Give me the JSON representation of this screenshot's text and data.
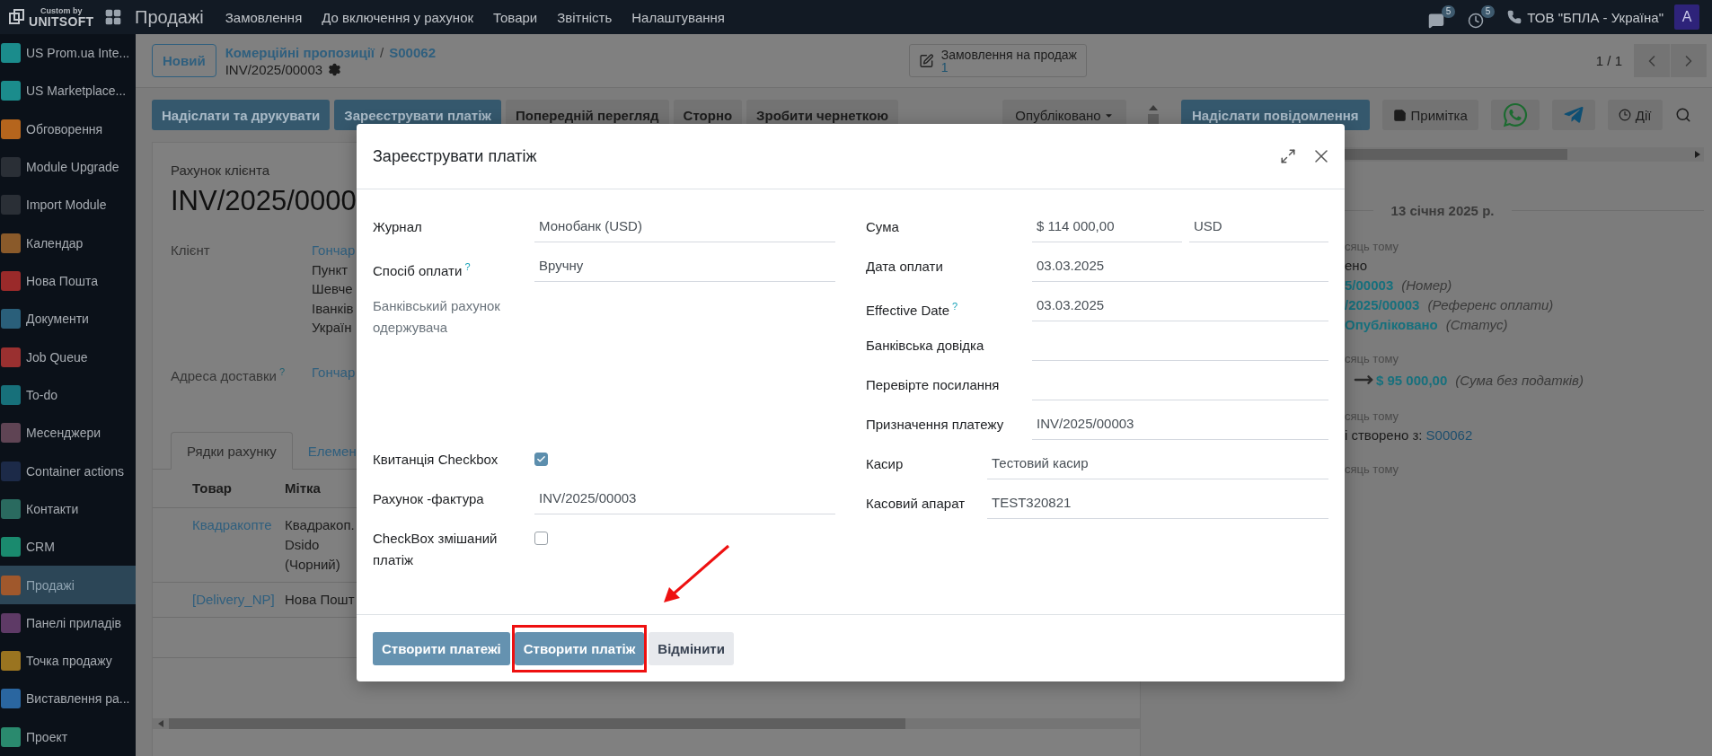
{
  "topbar": {
    "brand_caption": "Custom by",
    "brand_name": "UNITSOFT",
    "app": "Продажі",
    "menu": [
      "Замовлення",
      "До включення у рахунок",
      "Товари",
      "Звітність",
      "Налаштування"
    ],
    "messages_badge": "5",
    "activities_badge": "5",
    "company": "ТОВ \"БПЛА - Україна\"",
    "avatar": "A"
  },
  "sidebar": {
    "items": [
      {
        "label": "US Prom.ua Inte...",
        "selected": false,
        "color": "#1b8c8c"
      },
      {
        "label": "US Marketplace...",
        "selected": false,
        "color": "#1b8c8c"
      },
      {
        "label": "Обговорення",
        "selected": false,
        "color": "#b5651d"
      },
      {
        "label": "Module Upgrade",
        "selected": false,
        "color": "#2a2f36"
      },
      {
        "label": "Import Module",
        "selected": false,
        "color": "#2a2f36"
      },
      {
        "label": "Календар",
        "selected": false,
        "color": "#8a5a2a"
      },
      {
        "label": "Нова Пошта",
        "selected": false,
        "color": "#9a2a2a"
      },
      {
        "label": "Документи",
        "selected": false,
        "color": "#2a5f7a"
      },
      {
        "label": "Job Queue",
        "selected": false,
        "color": "#9a3030"
      },
      {
        "label": "To-do",
        "selected": false,
        "color": "#17707a"
      },
      {
        "label": "Месенджери",
        "selected": false,
        "color": "#5f4454"
      },
      {
        "label": "Container actions",
        "selected": false,
        "color": "#1c2a48"
      },
      {
        "label": "Контакти",
        "selected": false,
        "color": "#2a6a5f"
      },
      {
        "label": "CRM",
        "selected": false,
        "color": "#1a8a6e"
      },
      {
        "label": "Продажі",
        "selected": true,
        "color": "#a0582c"
      },
      {
        "label": "Панелі приладів",
        "selected": false,
        "color": "#5e3a66"
      },
      {
        "label": "Точка продажу",
        "selected": false,
        "color": "#9a7420"
      },
      {
        "label": "Виставлення ра...",
        "selected": false,
        "color": "#2a66a0"
      },
      {
        "label": "Проект",
        "selected": false,
        "color": "#2a8a6e"
      }
    ]
  },
  "control_panel": {
    "new_button": "Новий",
    "breadcrumb": [
      "Комерційні пропозиції",
      "S00062"
    ],
    "breadcrumb_separator": "/",
    "record": "INV/2025/00003",
    "smart_button": {
      "label": "Замовлення на продаж",
      "count": "1"
    },
    "pager": "1 / 1"
  },
  "action_buttons": [
    {
      "label": "Надіслати та друкувати",
      "kind": "primary"
    },
    {
      "label": "Зареєструвати платіж",
      "kind": "primary"
    },
    {
      "label": "Попередній перегляд",
      "kind": "secondary"
    },
    {
      "label": "Сторно",
      "kind": "secondary"
    },
    {
      "label": "Зробити чернеткою",
      "kind": "secondary"
    }
  ],
  "status_button": "Опубліковано",
  "form": {
    "subtitle": "Рахунок клієнта",
    "title": "INV/2025/0000",
    "client_label": "Клієнт",
    "client_name": "Гончар",
    "client_address": [
      "Пункт",
      "Шевче",
      "Іванків",
      "Україн"
    ],
    "delivery_label": "Адреса доставки",
    "delivery_help": "?",
    "delivery_name": "Гончар",
    "tabs": [
      {
        "label": "Рядки рахунку",
        "selected": true
      },
      {
        "label": "Елемен",
        "selected": false
      }
    ],
    "columns": [
      "Товар",
      "Мітка"
    ],
    "rows": [
      {
        "product": "Квадракопте",
        "label_lines": [
          "Квадракоп.",
          "Dsido",
          "(Чорний)"
        ]
      },
      {
        "product": "[Delivery_NP]",
        "label_lines": [
          "Нова Пошт"
        ]
      }
    ]
  },
  "chatter": {
    "buttons": [
      {
        "label": "Надіслати повідомлення",
        "kind": "primary"
      },
      {
        "label": "Примітка",
        "kind": "note"
      },
      {
        "kind": "whatsapp"
      },
      {
        "kind": "telegram"
      },
      {
        "label": "Дії",
        "kind": "activity"
      }
    ],
    "date": "13 січня 2025 р.",
    "entries": [
      {
        "time": "сяць тому",
        "lines": [
          {
            "kind": "text",
            "text": "ено"
          },
          {
            "kind": "change",
            "value": "5/00003",
            "field": "(Номер)"
          },
          {
            "kind": "change",
            "value": "/2025/00003",
            "field": "(Референс оплати)"
          },
          {
            "kind": "change",
            "value": "Опубліковано",
            "field": "(Статус)"
          }
        ]
      },
      {
        "time": "сяць тому",
        "lines": [
          {
            "kind": "arrow_change",
            "value": "$ 95 000,00",
            "field": "(Сума без податків)"
          }
        ]
      },
      {
        "time": "сяць тому",
        "lines": [
          {
            "kind": "link_text",
            "text": "і створено з:",
            "link": "S00062"
          }
        ]
      },
      {
        "time": "сяць тому"
      }
    ]
  },
  "dialog": {
    "title": "Зареєструвати платіж",
    "left_groups": [
      {
        "fields": [
          {
            "label": "Журнал",
            "kind": "text",
            "value": "Монобанк (USD)",
            "readonly": false
          },
          {
            "label": "Спосіб оплати",
            "help_mark": "?",
            "kind": "text",
            "value": "Вручну",
            "readonly": false
          },
          {
            "label": "Банківський рахунок одержувача",
            "kind": "none",
            "readonly": true
          }
        ]
      },
      {
        "fields": [
          {
            "label": "Квитанція Checkbox",
            "kind": "checkbox",
            "checked": true,
            "readonly": false
          },
          {
            "label": "Рахунок -фактура",
            "kind": "text",
            "value": "INV/2025/00003",
            "readonly": false
          },
          {
            "label": "CheckBox змішаний платіж",
            "kind": "checkbox",
            "checked": false,
            "readonly": false
          }
        ]
      }
    ],
    "right_groups": [
      {
        "fields": [
          {
            "label": "Сума",
            "kind": "amount",
            "value": "$ 114 000,00",
            "currency": "USD",
            "readonly": false
          },
          {
            "label": "Дата оплати",
            "kind": "text",
            "value": "03.03.2025",
            "readonly": false
          },
          {
            "label": "Effective Date",
            "help_mark": "?",
            "kind": "text",
            "value": "03.03.2025",
            "readonly": false
          },
          {
            "label": "Банківська довідка",
            "kind": "text",
            "readonly": false
          },
          {
            "label": "Перевірте посилання",
            "kind": "text",
            "readonly": false
          },
          {
            "label": "Призначення платежу",
            "kind": "text",
            "value": "INV/2025/00003",
            "readonly": false
          }
        ]
      },
      {
        "fields": [
          {
            "label": "Касир",
            "kind": "text",
            "value": "Тестовий касир",
            "readonly": false
          },
          {
            "label": "Касовий апарат",
            "kind": "text",
            "value": "TEST320821",
            "readonly": false
          }
        ]
      }
    ],
    "buttons": [
      {
        "label": "Створити платежі",
        "kind": "primary",
        "highlighted": false
      },
      {
        "label": "Створити платіж",
        "kind": "primary",
        "highlighted": true
      },
      {
        "label": "Відмінити",
        "kind": "secondary",
        "highlighted": false
      }
    ]
  }
}
